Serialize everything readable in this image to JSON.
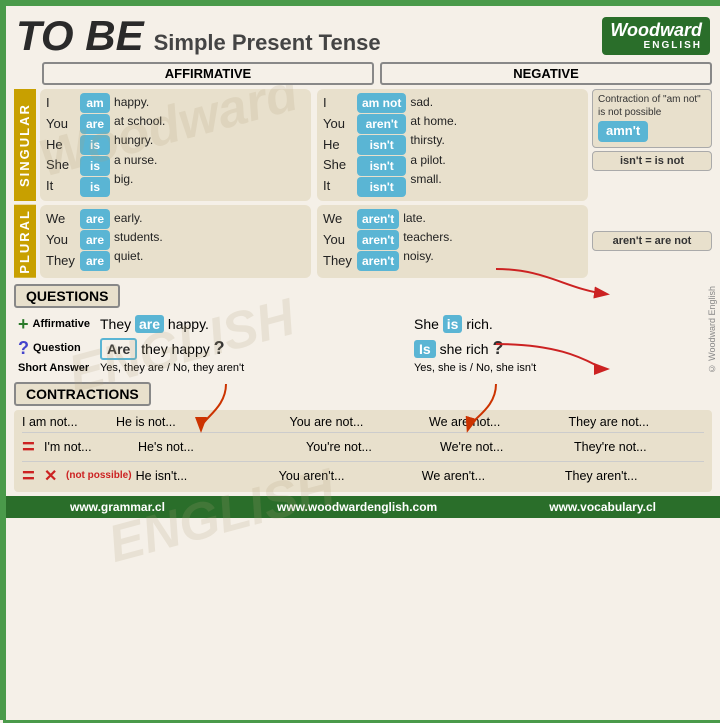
{
  "header": {
    "title_tobe": "TO BE",
    "title_sub": "Simple Present Tense",
    "logo_name": "Woodward",
    "logo_sub": "ENGLISH"
  },
  "labels": {
    "affirmative": "AFFIRMATIVE",
    "negative": "NEGATIVE",
    "singular": "SINGULAR",
    "plural": "PLURAL",
    "questions": "QUESTIONS",
    "contractions": "CONTRACTIONS"
  },
  "singular": {
    "affirmative": {
      "subjects": [
        "I",
        "You",
        "He",
        "She",
        "It"
      ],
      "verbs": [
        "am",
        "are",
        "is",
        "is",
        "is"
      ],
      "sentences": [
        "happy.",
        "at school.",
        "hungry.",
        "a nurse.",
        "big."
      ]
    },
    "negative": {
      "subjects": [
        "I",
        "You",
        "He",
        "She",
        "It"
      ],
      "verbs": [
        "am not",
        "aren't",
        "isn't",
        "isn't",
        "isn't"
      ],
      "sentences": [
        "sad.",
        "at home.",
        "thirsty.",
        "a pilot.",
        "small."
      ]
    }
  },
  "plural": {
    "affirmative": {
      "subjects": [
        "We",
        "You",
        "They"
      ],
      "verbs": [
        "are",
        "are",
        "are"
      ],
      "sentences": [
        "early.",
        "students.",
        "quiet."
      ]
    },
    "negative": {
      "subjects": [
        "We",
        "You",
        "They"
      ],
      "verbs": [
        "aren't",
        "aren't",
        "aren't"
      ],
      "sentences": [
        "late.",
        "teachers.",
        "noisy."
      ]
    }
  },
  "annotations": {
    "contraction_note": "Contraction of \"am not\" is not possible",
    "amnt": "amn't",
    "isnt_eq": "isn't = is not",
    "arent_eq": "aren't = are not"
  },
  "questions": {
    "affirmative_label": "Affirmative",
    "question_label": "Question",
    "short_answer_label": "Short Answer",
    "aff1": "They",
    "are1": "are",
    "aff1b": "happy.",
    "aff2": "She",
    "is1": "is",
    "aff2b": "rich.",
    "q1_verb": "Are",
    "q1_rest": "they happy",
    "q1_mark": "?",
    "q2_verb": "Is",
    "q2_rest": "she rich",
    "q2_mark": "?",
    "short1": "Yes, they are / No, they aren't",
    "short2": "Yes, she is / No, she isn't"
  },
  "contractions_table": {
    "rows": [
      {
        "symbol": "",
        "cols": [
          "I am not...",
          "He is not...",
          "You are not...",
          "We are not...",
          "They are not..."
        ]
      },
      {
        "symbol": "=",
        "cols": [
          "I'm not...",
          "He's not...",
          "You're not...",
          "We're not...",
          "They're not..."
        ]
      },
      {
        "symbol": "= x",
        "cols": [
          "He isn't...",
          "You aren't...",
          "We aren't...",
          "They aren't..."
        ]
      }
    ],
    "not_possible_label": "(not possible)"
  },
  "footer": {
    "links": [
      "www.grammar.cl",
      "www.woodwardenglish.com",
      "www.vocabulary.cl"
    ]
  }
}
